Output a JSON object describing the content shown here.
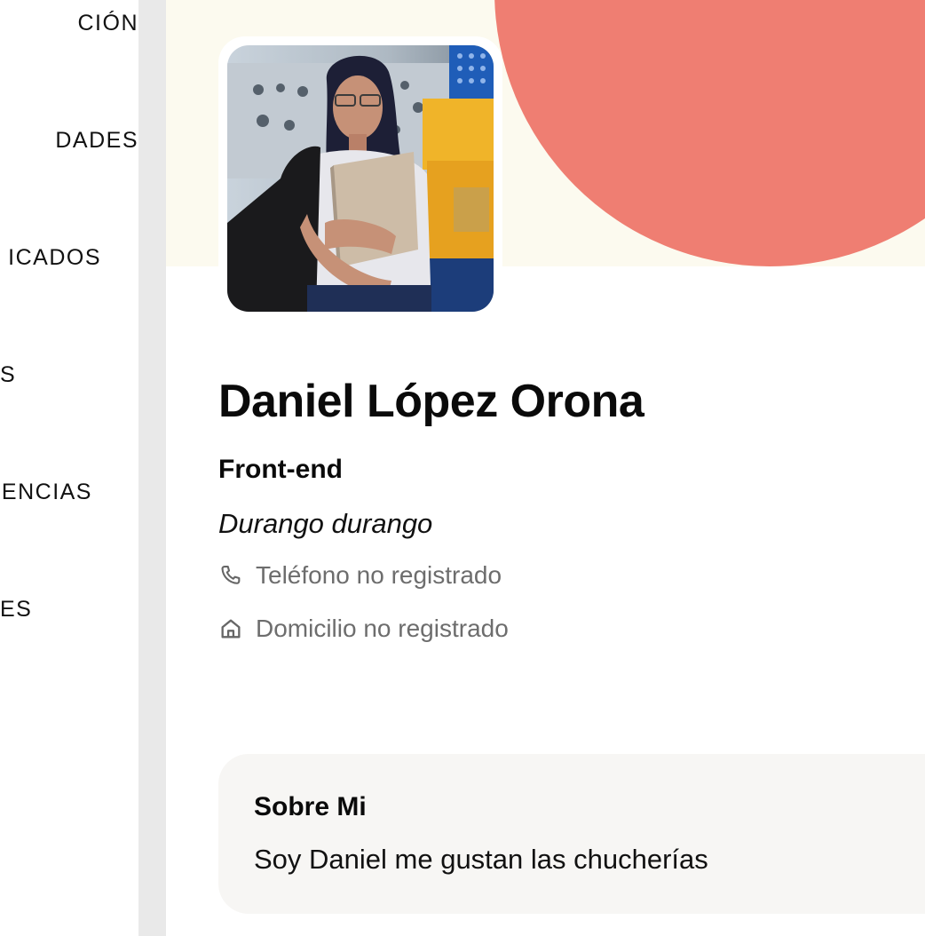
{
  "sidebar": {
    "items": [
      {
        "label": "CIÓN"
      },
      {
        "label": "DADES"
      },
      {
        "label": "ICADOS"
      },
      {
        "label": "S"
      },
      {
        "label": "ENCIAS"
      },
      {
        "label": "ES"
      }
    ]
  },
  "profile": {
    "name": "Daniel López Orona",
    "role": "Front-end",
    "location": "Durango durango",
    "phone": {
      "icon": "phone-icon",
      "text": "Teléfono no registrado"
    },
    "address": {
      "icon": "home-icon",
      "text": "Domicilio no registrado"
    }
  },
  "about": {
    "title": "Sobre Mi",
    "text": "Soy Daniel me gustan las chucherías"
  },
  "colors": {
    "banner_bg": "#fcfaef",
    "banner_circle": "#ef7e72",
    "divider": "#e9e9e9",
    "about_card_bg": "#f7f6f4",
    "muted_text": "#6d6d6d"
  }
}
